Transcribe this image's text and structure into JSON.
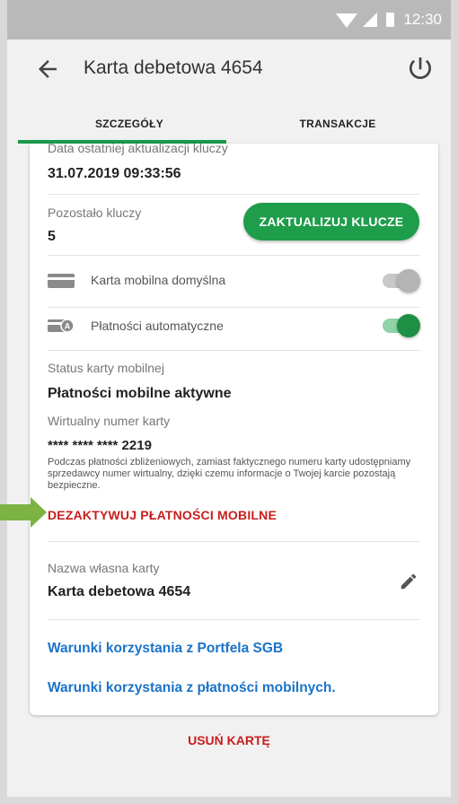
{
  "status_bar": {
    "time": "12:30"
  },
  "header": {
    "title": "Karta debetowa 4654"
  },
  "tabs": [
    {
      "label": "SZCZEGÓŁY"
    },
    {
      "label": "TRANSAKCJE"
    }
  ],
  "details": {
    "last_update_label": "Data ostatniej aktualizacji kluczy",
    "last_update_value": "31.07.2019 09:33:56",
    "keys_left_label": "Pozostało kluczy",
    "keys_left_value": "5",
    "update_button": "ZAKTUALIZUJ KLUCZE",
    "default_card_label": "Karta mobilna domyślna",
    "default_card_enabled": false,
    "auto_payments_label": "Płatności automatyczne",
    "auto_payments_enabled": true,
    "mobile_status_label": "Status karty mobilnej",
    "mobile_status_value": "Płatności mobilne aktywne",
    "virtual_number_label": "Wirtualny numer karty",
    "virtual_number_value": "**** **** **** 2219",
    "virtual_info": "Podczas płatności zbliżeniowych, zamiast faktycznego numeru karty udostępniamy sprzedawcy numer wirtualny, dzięki czemu informacje o Twojej karcie pozostają bezpieczne.",
    "deactivate_link": "DEZAKTYWUJ PŁATNOŚCI MOBILNE",
    "own_name_label": "Nazwa własna karty",
    "own_name_value": "Karta debetowa 4654",
    "terms_wallet": "Warunki korzystania z Portfela SGB",
    "terms_mobile": "Warunki korzystania z płatności mobilnych."
  },
  "remove_card": "USUŃ KARTĘ",
  "colors": {
    "accent_green": "#1e9d4a",
    "danger_red": "#c81d1d",
    "link_blue": "#1a73c9"
  }
}
